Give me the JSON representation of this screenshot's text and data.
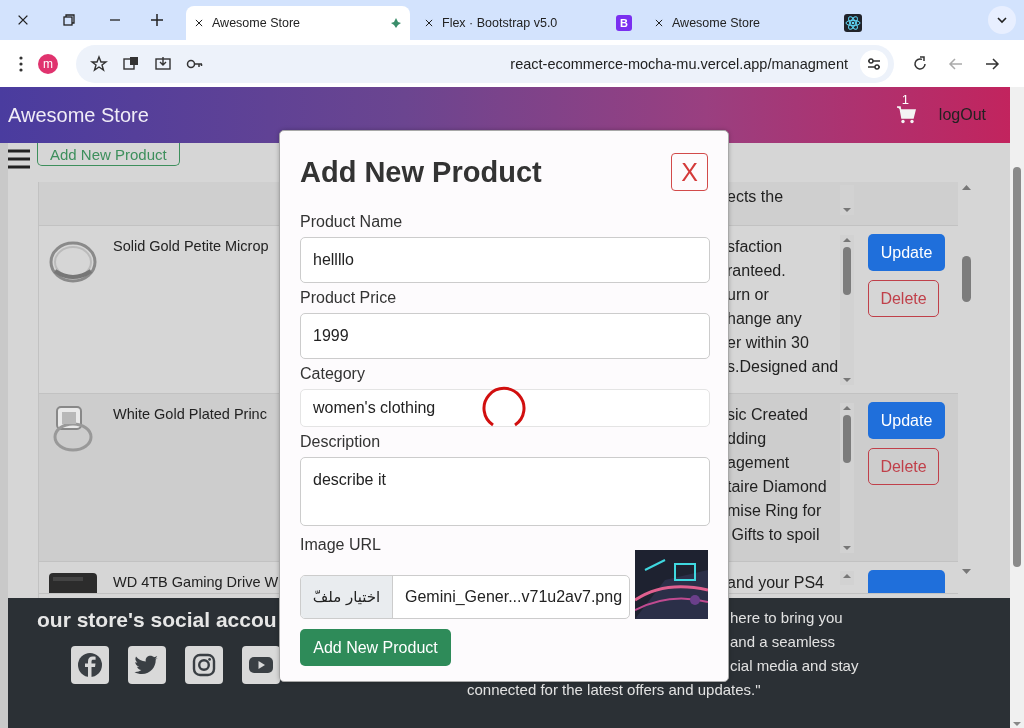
{
  "browser": {
    "tabs": [
      {
        "title": "Awesome Store",
        "selected": true
      },
      {
        "title": "Flex · Bootstrap v5.0",
        "selected": false,
        "favicon_text": "B"
      },
      {
        "title": "Awesome Store",
        "selected": false
      }
    ],
    "profile_initial": "m",
    "url": "react-ecommerce-mocha-mu.vercel.app/managment"
  },
  "navbar": {
    "brand": "Awesome Store",
    "cart_count": "1",
    "logout": "logOut"
  },
  "toolbar": {
    "add_button": "Add New Product"
  },
  "table": {
    "rows": [
      {
        "kind": "top",
        "description_lines": [
          "ects the"
        ]
      },
      {
        "kind": "full",
        "name": "Solid Gold Petite Microp",
        "description_lines": [
          "sfaction",
          "ranteed.",
          "urn or",
          "hange any",
          "er within 30",
          "s.Designed and"
        ],
        "update": "Update",
        "delete": "Delete"
      },
      {
        "kind": "full",
        "name": "White Gold Plated Princ",
        "description_lines": [
          "sic Created",
          "dding",
          "agement",
          "taire Diamond",
          "mise Ring for",
          " Gifts to spoil"
        ],
        "update": "Update",
        "delete": "Delete"
      },
      {
        "kind": "bottom",
        "name": "WD 4TB Gaming Drive W",
        "description_lines": [
          "and your PS4"
        ]
      }
    ]
  },
  "footer": {
    "title": "our store's social accou",
    "text_lines": [
      "here to bring you",
      "and a seamless",
      "cial media and stay",
      "connected for the latest offers and updates.\""
    ]
  },
  "modal": {
    "title": "Add New Product",
    "close": "X",
    "loading": true,
    "fields": [
      {
        "kind": "text",
        "label": "Product Name",
        "value": "hellllo"
      },
      {
        "kind": "text",
        "label": "Product Price",
        "value": "1999"
      },
      {
        "kind": "select",
        "label": "Category",
        "value": "women's clothing"
      },
      {
        "kind": "textarea",
        "label": "Description",
        "value": "describe it"
      },
      {
        "kind": "file",
        "label": "Image URL",
        "button": "اختيار ملفّ",
        "value": "Gemini_Gener...v71u2av7.png"
      }
    ],
    "submit": "Add New Product"
  }
}
